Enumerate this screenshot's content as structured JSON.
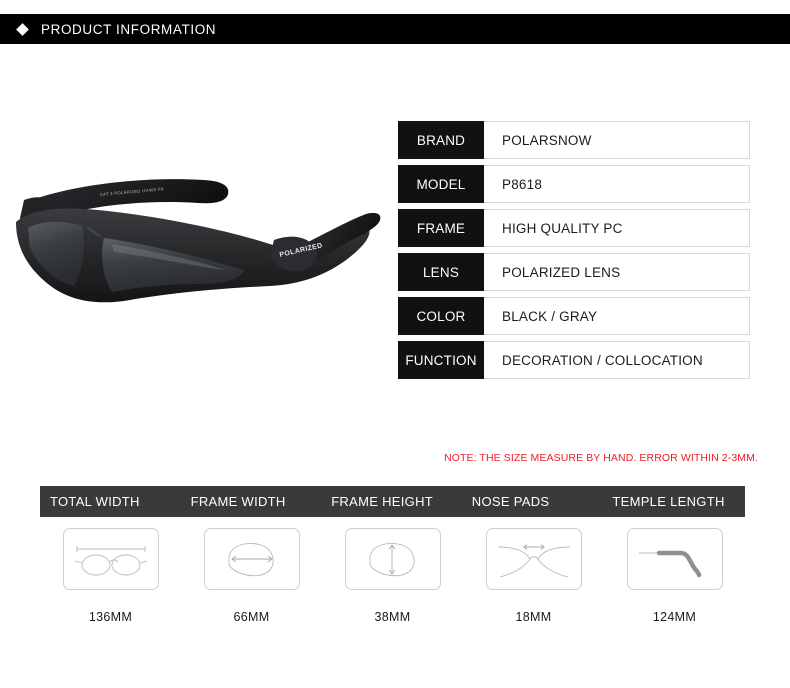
{
  "banner": {
    "bullet_icon": "diamond-icon",
    "title": "PRODUCT INFORMATION"
  },
  "product_photo": {
    "alt": "black polarized sport sunglasses",
    "temple_brand_text": "POLARIZED",
    "temple_small_text": "CAT 3 POLARIZED UV400 FR"
  },
  "spec_table": {
    "rows": [
      {
        "label": "BRAND",
        "value": "POLARSNOW"
      },
      {
        "label": "MODEL",
        "value": "P8618"
      },
      {
        "label": "FRAME",
        "value": "HIGH QUALITY PC"
      },
      {
        "label": "LENS",
        "value": "POLARIZED LENS"
      },
      {
        "label": "COLOR",
        "value": "BLACK / GRAY"
      },
      {
        "label": "FUNCTION",
        "value": "DECORATION / COLLOCATION"
      }
    ]
  },
  "note": {
    "text": "NOTE: THE SIZE MEASURE BY HAND. ERROR WITHIN 2-3MM.",
    "color": "#ee1c25"
  },
  "measurements": {
    "header_background": "#3a3a3a",
    "columns": [
      {
        "header": "TOTAL WIDTH",
        "value": "136MM",
        "diagram": "full-glasses-width-icon"
      },
      {
        "header": "FRAME WIDTH",
        "value": "66MM",
        "diagram": "lens-width-icon"
      },
      {
        "header": "FRAME HEIGHT",
        "value": "38MM",
        "diagram": "lens-height-icon"
      },
      {
        "header": "NOSE PADS",
        "value": "18MM",
        "diagram": "nose-bridge-icon"
      },
      {
        "header": "TEMPLE LENGTH",
        "value": "124MM",
        "diagram": "temple-arm-icon"
      }
    ]
  }
}
